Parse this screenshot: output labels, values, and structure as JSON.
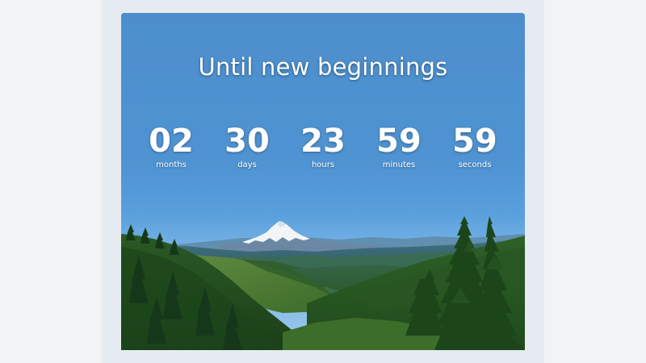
{
  "hero": {
    "title": "Until new beginnings",
    "background": "mountain-forest-landscape"
  },
  "countdown": [
    {
      "value": "02",
      "label": "months"
    },
    {
      "value": "30",
      "label": "days"
    },
    {
      "value": "23",
      "label": "hours"
    },
    {
      "value": "59",
      "label": "minutes"
    },
    {
      "value": "59",
      "label": "seconds"
    }
  ],
  "colors": {
    "sky_top": "#4b8ccb",
    "sky_horizon": "#7fb5e6",
    "forest_dark": "#1e4a1c",
    "forest_light": "#4e7a32",
    "snow": "#f4f6f8",
    "text": "#ffffff"
  }
}
